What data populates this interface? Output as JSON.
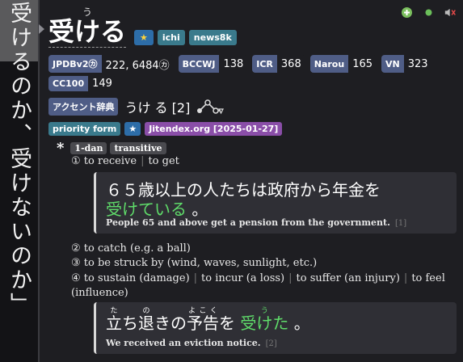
{
  "sentence": "受けるのか、受けないのか」",
  "headword": {
    "text": "受ける",
    "reading": "う"
  },
  "tags": [
    "★",
    "ichi",
    "news8k"
  ],
  "frequencies": [
    {
      "label": "JPDBv2㋕",
      "value": "222, 6484㋕"
    },
    {
      "label": "BCCWJ",
      "value": "138"
    },
    {
      "label": "ICR",
      "value": "368"
    },
    {
      "label": "Narou",
      "value": "165"
    },
    {
      "label": "VN",
      "value": "323"
    },
    {
      "label": "CC100",
      "value": "149"
    }
  ],
  "pitch": {
    "label": "アクセント辞典",
    "reading": "うけ る",
    "number": "[2]"
  },
  "sources": [
    "priority form",
    "★",
    "Jitendex.org [2025-01-27]"
  ],
  "pos_tags": [
    "1-dan",
    "transitive"
  ],
  "senses": [
    {
      "num": "①",
      "glosses": [
        "to receive",
        "to get"
      ]
    },
    {
      "num": "②",
      "glosses": [
        "to catch (e.g. a ball)"
      ]
    },
    {
      "num": "③",
      "glosses": [
        "to be struck by (wind, waves, sunlight, etc.)"
      ]
    },
    {
      "num": "④",
      "glosses": [
        "to sustain (damage)",
        "to incur (a loss)",
        "to suffer (an injury)",
        "to feel (influence)"
      ]
    }
  ],
  "examples": [
    {
      "jp_before": "６５歳以上の人たちは政府から年金を",
      "jp_highlight": "受けている",
      "jp_after": "。",
      "en": "People 65 and above get a pension from the government.",
      "ref": "[1]"
    },
    {
      "jp_parts": [
        {
          "base": "立",
          "rt": "た"
        },
        {
          "base": "ち",
          "rt": ""
        },
        {
          "base": "退",
          "rt": "の"
        },
        {
          "base": "き",
          "rt": ""
        },
        {
          "base": "の",
          "rt": ""
        },
        {
          "base": "予告",
          "rt": "よこく"
        },
        {
          "base": "を",
          "rt": ""
        }
      ],
      "jp_highlight": "受けた",
      "jp_highlight_rt": "う",
      "jp_after": "。",
      "en": "We received an eviction notice.",
      "ref": "[2]"
    }
  ],
  "colors": {
    "accent": "#5fdc6a",
    "tag": "#3a7a8c",
    "freq_label": "#4f5d86",
    "jitendex": "#8a4ea8",
    "priority": "#3a7a8c"
  },
  "icons": [
    "add-icon",
    "dot-icon",
    "audio-muted-icon"
  ]
}
